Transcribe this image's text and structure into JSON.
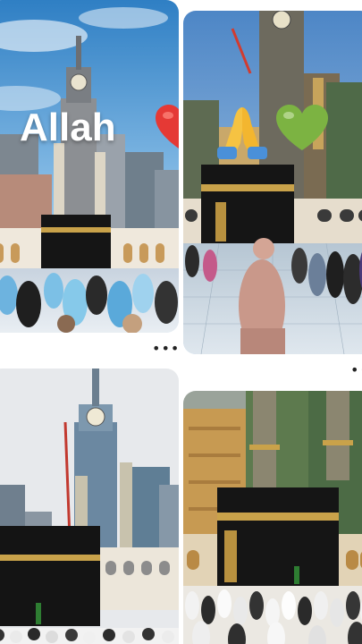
{
  "pins": [
    {
      "id": "pin-1",
      "overlay_text": "Allah",
      "emojis": [
        "red-heart",
        "praying-hands",
        "green-heart"
      ]
    },
    {
      "id": "pin-2"
    },
    {
      "id": "pin-3"
    },
    {
      "id": "pin-4"
    }
  ],
  "more_glyph": "•••",
  "colors": {
    "sky": "#5a9fd4",
    "kaaba_black": "#151515",
    "kiswah_gold": "#c9a24a",
    "tower_stone": "#8a8f96",
    "heart_red": "#e53935",
    "heart_green": "#7cb342",
    "hands_yellow": "#f6c342",
    "sleeve_blue": "#4a90d9"
  },
  "icons": [
    "more-options-icon",
    "red-heart-icon",
    "praying-hands-icon",
    "green-heart-icon"
  ]
}
